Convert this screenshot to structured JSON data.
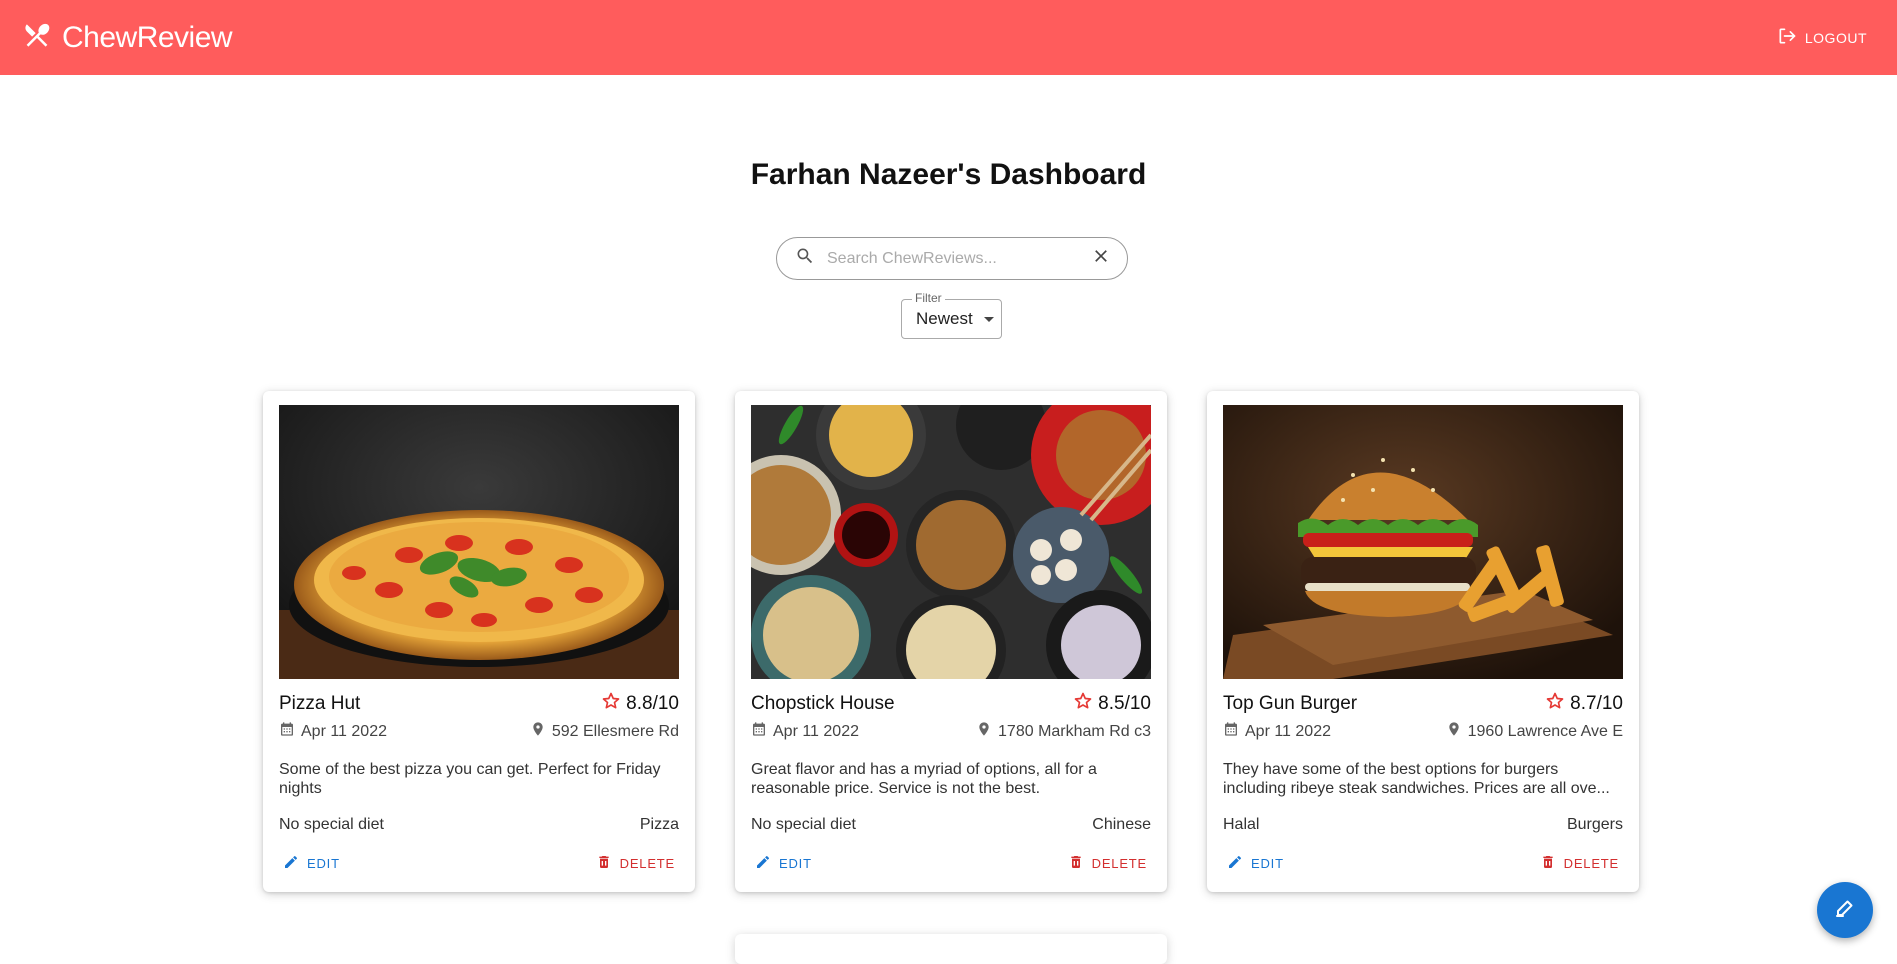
{
  "header": {
    "brand": "ChewReview",
    "logout_label": "LOGOUT",
    "background_color": "#ff5c5c"
  },
  "page": {
    "title": "Farhan Nazeer's Dashboard"
  },
  "search": {
    "placeholder": "Search ChewReviews...",
    "value": ""
  },
  "filter": {
    "label": "Filter",
    "selected": "Newest"
  },
  "cards": [
    {
      "name": "Pizza Hut",
      "rating": "8.8/10",
      "date": "Apr 11 2022",
      "address": "592 Ellesmere Rd",
      "description": "Some of the best pizza you can get. Perfect for Friday nights",
      "diet": "No special diet",
      "cuisine": "Pizza",
      "edit_label": "EDIT",
      "delete_label": "DELETE",
      "image": "pizza-photo"
    },
    {
      "name": "Chopstick House",
      "rating": "8.5/10",
      "date": "Apr 11 2022",
      "address": "1780 Markham Rd c3",
      "description": "Great flavor and has a myriad of options, all for a reasonable price. Service is not the best.",
      "diet": "No special diet",
      "cuisine": "Chinese",
      "edit_label": "EDIT",
      "delete_label": "DELETE",
      "image": "chinese-food-photo"
    },
    {
      "name": "Top Gun Burger",
      "rating": "8.7/10",
      "date": "Apr 11 2022",
      "address": "1960 Lawrence Ave E",
      "description": "They have some of the best options for burgers including ribeye steak sandwiches. Prices are all ove...",
      "diet": "Halal",
      "cuisine": "Burgers",
      "edit_label": "EDIT",
      "delete_label": "DELETE",
      "image": "burger-photo"
    }
  ],
  "colors": {
    "accent": "#1976d2",
    "danger": "#d32f2f",
    "star": "#e53935"
  },
  "fab": {
    "icon": "edit-note-icon"
  }
}
